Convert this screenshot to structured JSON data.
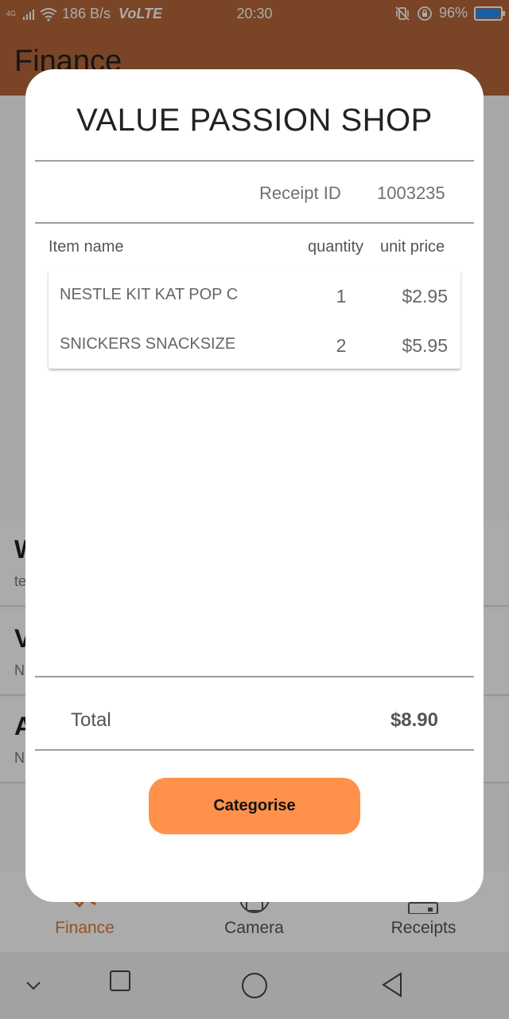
{
  "status_bar": {
    "network": "4G",
    "speed": "186 B/s",
    "volte": "VoLTE",
    "time": "20:30",
    "battery_percent": "96%",
    "battery_level": 0.96,
    "battery_color": "#1e90ff"
  },
  "app_bar": {
    "title": "Finance",
    "color": "#b5673a"
  },
  "background_list": [
    {
      "title": "W",
      "subtitle": "te"
    },
    {
      "title": "V",
      "subtitle": "N"
    },
    {
      "title": "A",
      "subtitle": "N"
    }
  ],
  "bottom_nav": {
    "items": [
      {
        "label": "Finance",
        "icon": "finance-icon",
        "active": true
      },
      {
        "label": "Camera",
        "icon": "camera-icon",
        "active": false
      },
      {
        "label": "Receipts",
        "icon": "receipts-icon",
        "active": false
      }
    ],
    "active_color": "#e07a33"
  },
  "dialog": {
    "shop_name": "VALUE PASSION SHOP",
    "receipt_id_label": "Receipt ID",
    "receipt_id": "1003235",
    "columns": {
      "name": "Item name",
      "quantity": "quantity",
      "unit_price": "unit price"
    },
    "items": [
      {
        "name": "NESTLE KIT KAT POP C",
        "quantity": "1",
        "unit_price": "$2.95"
      },
      {
        "name": "SNICKERS SNACKSIZE",
        "quantity": "2",
        "unit_price": "$5.95"
      }
    ],
    "total_label": "Total",
    "total_value": "$8.90",
    "categorise_button": "Categorise",
    "button_color": "#ff914a"
  }
}
